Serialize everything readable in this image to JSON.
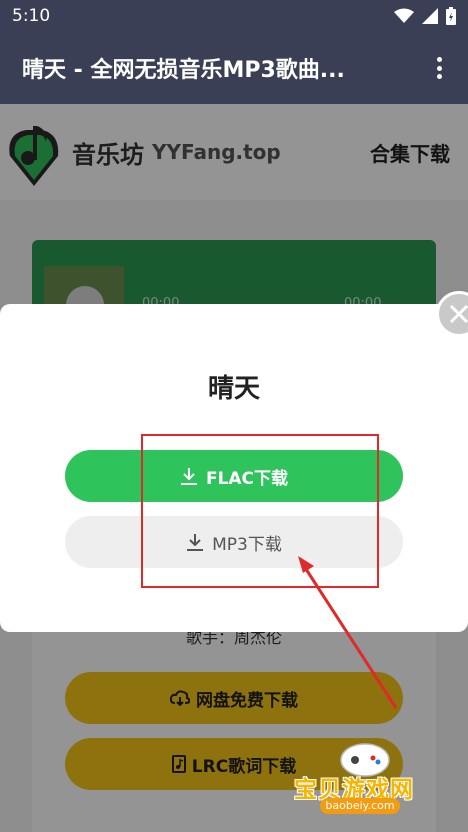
{
  "status_bar": {
    "time": "5:10"
  },
  "app_bar": {
    "title": "晴天 - 全网无损音乐MP3歌曲..."
  },
  "site": {
    "name": "音乐坊",
    "domain": "YYFang.top",
    "collection_link": "合集下载"
  },
  "player": {
    "time_elapsed": "00:00",
    "time_total": "00:00"
  },
  "song": {
    "singer_line": "歌手：周杰伦"
  },
  "page_buttons": {
    "pan_download": "网盘免费下载",
    "lrc_download": "LRC歌词下载"
  },
  "modal": {
    "title": "晴天",
    "flac_label": "FLAC下载",
    "mp3_label": "MP3下载"
  },
  "watermark": {
    "text": "宝贝游戏网",
    "url": "baobeiy.com"
  },
  "colors": {
    "app_bar": "#3b3f55",
    "flac_green": "#2fc35b",
    "annotation_red": "#e02a2a",
    "yellow": "#f5c518"
  }
}
